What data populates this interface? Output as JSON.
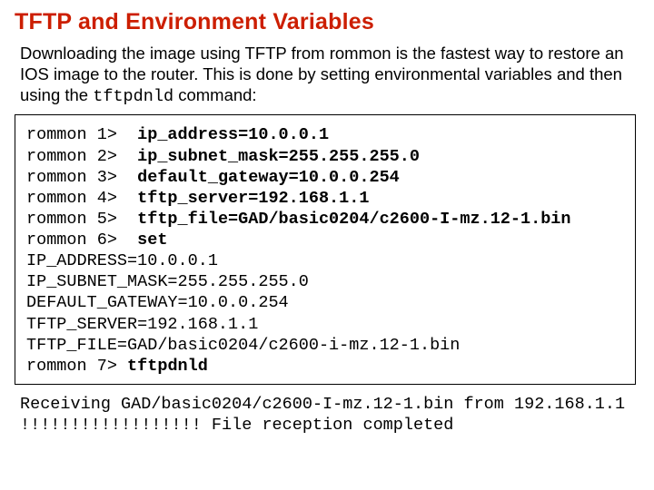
{
  "title": "TFTP and Environment Variables",
  "intro_pre": "Downloading the image using TFTP from rommon is the fastest way to restore an IOS image to the router. This is done by setting environmental variables and then using the ",
  "intro_code": "tftpdnld",
  "intro_post": " command:",
  "term": {
    "lines": [
      {
        "prompt": "rommon 1>  ",
        "cmd": "ip_address=10.0.0.1"
      },
      {
        "prompt": "rommon 2>  ",
        "cmd": "ip_subnet_mask=255.255.255.0"
      },
      {
        "prompt": "rommon 3>  ",
        "cmd": "default_gateway=10.0.0.254"
      },
      {
        "prompt": "rommon 4>  ",
        "cmd": "tftp_server=192.168.1.1"
      },
      {
        "prompt": "rommon 5>  ",
        "cmd": "tftp_file=GAD/basic0204/c2600-I-mz.12-1.bin"
      },
      {
        "prompt": "rommon 6>  ",
        "cmd": "set"
      }
    ],
    "echo": "IP_ADDRESS=10.0.0.1\nIP_SUBNET_MASK=255.255.255.0\nDEFAULT_GATEWAY=10.0.0.254\nTFTP_SERVER=192.168.1.1\nTFTP_FILE=GAD/basic0204/c2600-i-mz.12-1.bin",
    "final_prompt": "rommon 7> ",
    "final_cmd": "tftpdnld"
  },
  "footer": "Receiving GAD/basic0204/c2600-I-mz.12-1.bin from 192.168.1.1 !!!!!!!!!!!!!!!!!! File reception completed"
}
